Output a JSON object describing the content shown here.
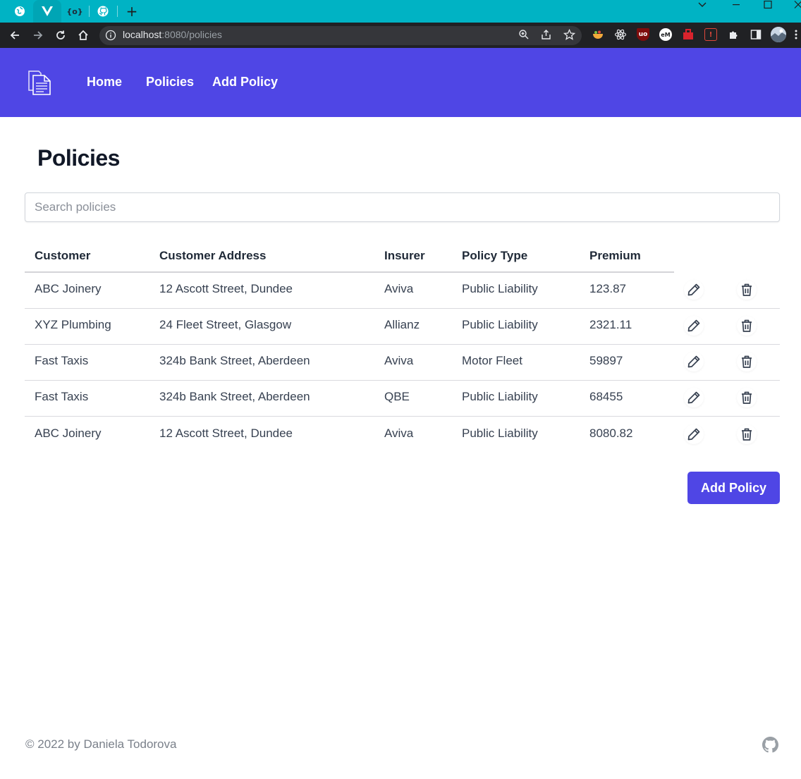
{
  "browser": {
    "url_host": "localhost",
    "url_path": ":8080/policies",
    "tabs": [
      {
        "icon": "globe-icon"
      },
      {
        "icon": "vue-logo-icon",
        "glyph": "V"
      },
      {
        "icon": "code-brackets-icon",
        "glyph": "{o}"
      },
      {
        "icon": "github-icon"
      }
    ],
    "new_tab_label": "+",
    "window_controls": [
      "⌄",
      "–",
      "☐",
      "✕"
    ],
    "colors": {
      "tabstrip": "#00b3c4",
      "toolbar": "#202124"
    }
  },
  "nav": {
    "home_label": "Home",
    "policies_label": "Policies",
    "add_policy_label": "Add Policy",
    "background": "#4f46e5"
  },
  "page": {
    "title": "Policies",
    "search_placeholder": "Search policies"
  },
  "table": {
    "columns": [
      "Customer",
      "Customer Address",
      "Insurer",
      "Policy Type",
      "Premium"
    ],
    "rows": [
      {
        "customer": "ABC Joinery",
        "address": "12 Ascott Street, Dundee",
        "insurer": "Aviva",
        "policy_type": "Public Liability",
        "premium": "123.87"
      },
      {
        "customer": "XYZ Plumbing",
        "address": "24 Fleet Street, Glasgow",
        "insurer": "Allianz",
        "policy_type": "Public Liability",
        "premium": "2321.11"
      },
      {
        "customer": "Fast Taxis",
        "address": "324b Bank Street, Aberdeen",
        "insurer": "Aviva",
        "policy_type": "Motor Fleet",
        "premium": "59897"
      },
      {
        "customer": "Fast Taxis",
        "address": "324b Bank Street, Aberdeen",
        "insurer": "QBE",
        "policy_type": "Public Liability",
        "premium": "68455"
      },
      {
        "customer": "ABC Joinery",
        "address": "12 Ascott Street, Dundee",
        "insurer": "Aviva",
        "policy_type": "Public Liability",
        "premium": "8080.82"
      }
    ],
    "row_actions": [
      "pencil-icon",
      "trash-icon"
    ]
  },
  "actions": {
    "add_policy_button": "Add Policy"
  },
  "footer": {
    "copyright": "© 2022 by Daniela Todorova",
    "icon": "github-icon"
  }
}
